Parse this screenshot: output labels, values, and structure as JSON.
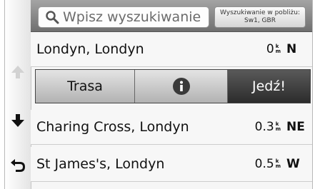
{
  "search": {
    "placeholder": "Wpisz wyszukiwanie",
    "nearby_line1": "Wyszukiwanie w pobliżu:",
    "nearby_line2": "Sw1, GBR"
  },
  "results": [
    {
      "name": "Londyn, Londyn",
      "distance": "0",
      "unit_top": "k",
      "unit_bottom": "m",
      "direction": "N"
    },
    {
      "name": "Charing Cross, Londyn",
      "distance": "0.3",
      "unit_top": "k",
      "unit_bottom": "m",
      "direction": "NE"
    },
    {
      "name": "St James's, Londyn",
      "distance": "0.5",
      "unit_top": "k",
      "unit_bottom": "m",
      "direction": "W"
    }
  ],
  "actions": {
    "route_label": "Trasa",
    "go_label": "Jedź!"
  },
  "icons": {
    "search": "search-icon",
    "info": "info-icon",
    "scroll_up": "arrow-up-icon",
    "scroll_down": "arrow-down-icon",
    "back": "back-icon"
  },
  "colors": {
    "go_button": "#3a3a3a",
    "topbar": "#8a8a8a"
  }
}
